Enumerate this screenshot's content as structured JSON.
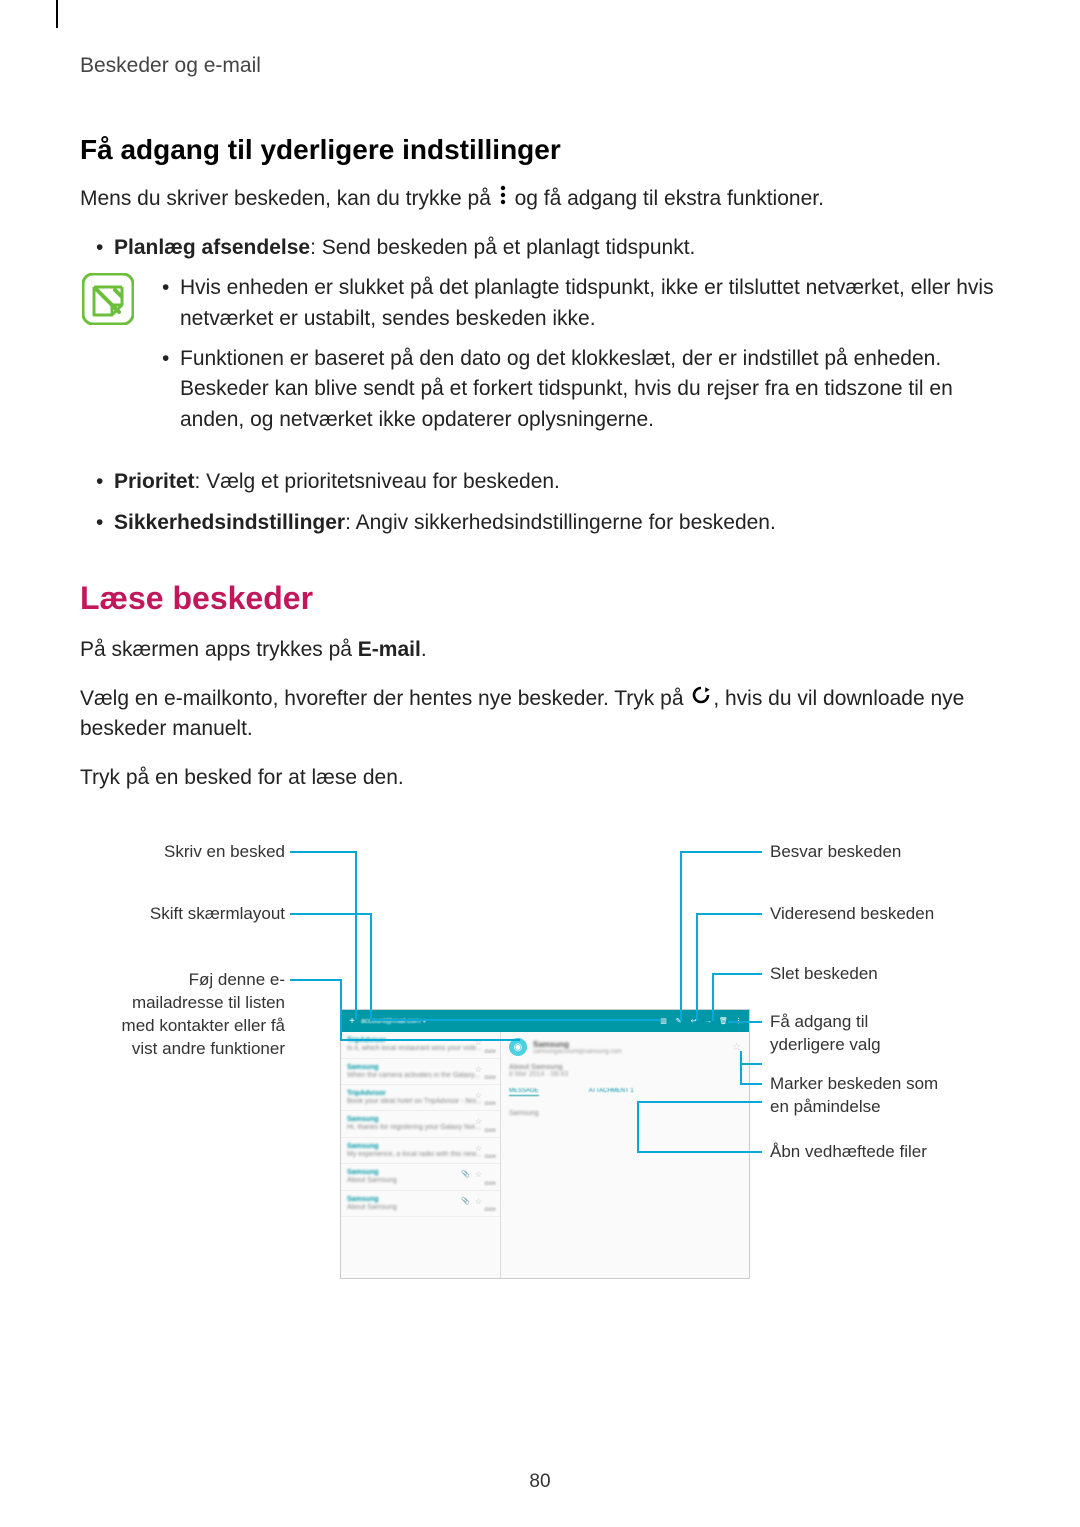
{
  "header": "Beskeder og e-mail",
  "section1": {
    "title": "Få adgang til yderligere indstillinger",
    "intro_a": "Mens du skriver beskeden, kan du trykke på ",
    "intro_b": " og få adgang til ekstra funktioner.",
    "bullet1_label": "Planlæg afsendelse",
    "bullet1_text": ": Send beskeden på et planlagt tidspunkt.",
    "note1": "Hvis enheden er slukket på det planlagte tidspunkt, ikke er tilsluttet netværket, eller hvis netværket er ustabilt, sendes beskeden ikke.",
    "note2": "Funktionen er baseret på den dato og det klokkeslæt, der er indstillet på enheden. Beskeder kan blive sendt på et forkert tidspunkt, hvis du rejser fra en tidszone til en anden, og netværket ikke opdaterer oplysningerne.",
    "bullet2_label": "Prioritet",
    "bullet2_text": ": Vælg et prioritetsniveau for beskeden.",
    "bullet3_label": "Sikkerhedsindstillinger",
    "bullet3_text": ": Angiv sikkerhedsindstillingerne for beskeden."
  },
  "section2": {
    "title": "Læse beskeder",
    "p1_a": "På skærmen apps trykkes på ",
    "p1_b": "E-mail",
    "p1_c": ".",
    "p2_a": "Vælg en e-mailkonto, hvorefter der hentes nye beskeder. Tryk på ",
    "p2_b": ", hvis du vil downloade nye beskeder manuelt.",
    "p3": "Tryk på en besked for at læse den."
  },
  "figure": {
    "l1": "Skriv en besked",
    "l2": "Skift skærmlayout",
    "l3": "Føj denne e-mailadresse til listen med kontakter eller få vist andre funktioner",
    "r1": "Besvar beskeden",
    "r2": "Videresend beskeden",
    "r3": "Slet beskeden",
    "r4": "Få adgang til yderligere valg",
    "r5": "Marker beskeden som en påmindelse",
    "r6": "Åbn vedhæftede filer"
  },
  "page_number": "80"
}
